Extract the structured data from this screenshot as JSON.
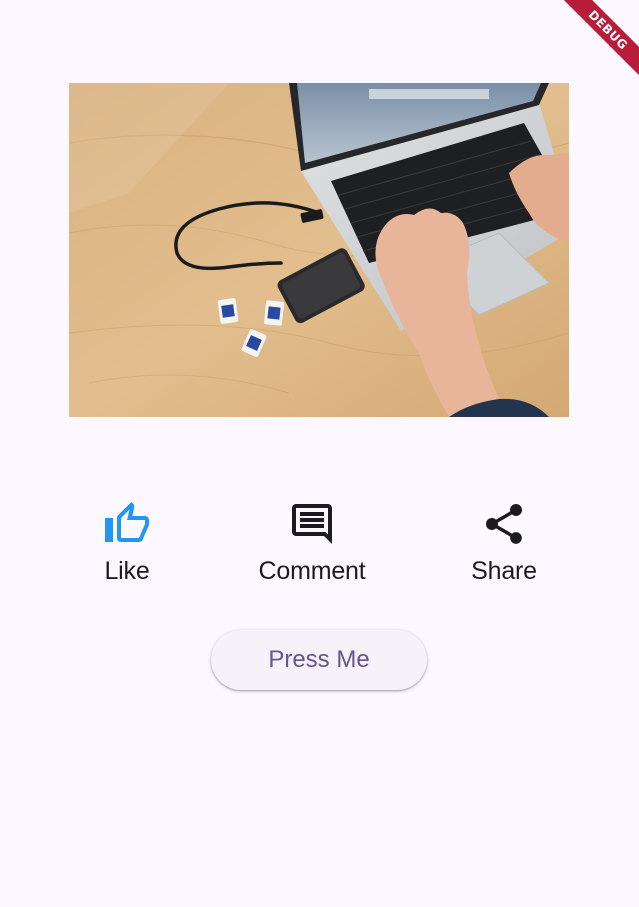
{
  "debug_banner": {
    "label": "DEBUG",
    "color": "#b71c3a"
  },
  "photo": {
    "subject": "laptop-ssd-sd-cards-photo"
  },
  "actions": [
    {
      "label": "Like",
      "icon": "thumb-up-icon",
      "color": "#2196f3"
    },
    {
      "label": "Comment",
      "icon": "comment-icon",
      "color": "#1d1b20"
    },
    {
      "label": "Share",
      "icon": "share-icon",
      "color": "#1d1b20"
    }
  ],
  "press_button": {
    "label": "Press Me",
    "text_color": "#65558f",
    "background": "#f7f2fa"
  },
  "colors": {
    "background": "#fdf7ff"
  }
}
